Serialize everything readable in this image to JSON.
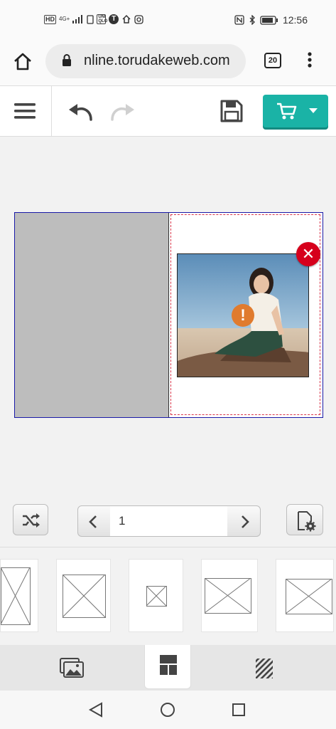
{
  "status_bar": {
    "left_icons": [
      "HD",
      "4G+",
      "signal-icon",
      "sim-icon",
      "UNI QLO",
      "T",
      "home-icon",
      "instagram-icon"
    ],
    "time": "12:56"
  },
  "browser": {
    "url": "nline.torudakeweb.com",
    "tab_count": "20"
  },
  "editor": {
    "page_number": "1"
  },
  "colors": {
    "cart": "#1ab3a6",
    "spread_border": "#1a1aa8",
    "dashed_guide": "#d9364a",
    "delete": "#d6001c",
    "warning": "#e07b2e",
    "left_page": "#bdbdbd"
  },
  "layout_templates": [
    {
      "name": "layout-full-partial"
    },
    {
      "name": "layout-large-photo"
    },
    {
      "name": "layout-small-photo"
    },
    {
      "name": "layout-landscape-photo"
    },
    {
      "name": "layout-landscape-photo-2"
    }
  ],
  "bottom_tabs": [
    {
      "icon": "photos-icon",
      "active": false
    },
    {
      "icon": "layout-icon",
      "active": true
    },
    {
      "icon": "background-pattern-icon",
      "active": false
    }
  ]
}
